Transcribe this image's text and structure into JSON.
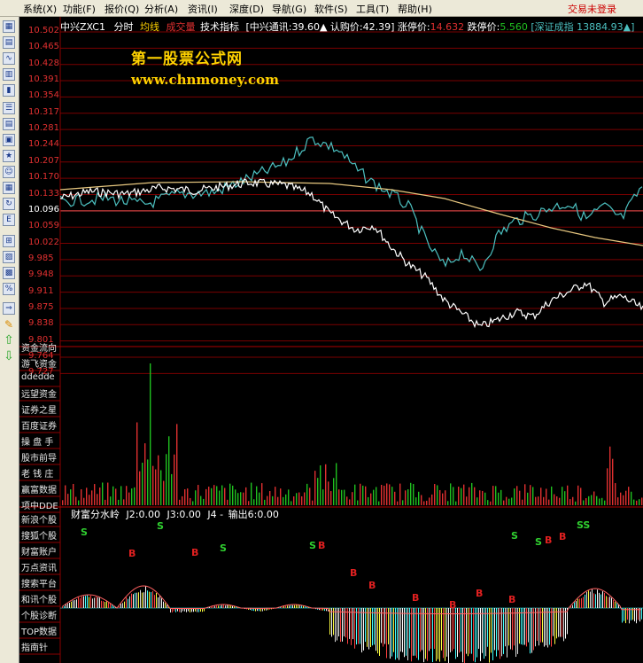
{
  "menu": [
    {
      "label": "系统(X)"
    },
    {
      "label": "功能(F)"
    },
    {
      "label": "报价(Q)"
    },
    {
      "label": "分析(A)"
    },
    {
      "label": "资讯(I)"
    },
    {
      "label": "深度(D)"
    },
    {
      "label": "导航(G)"
    },
    {
      "label": "软件(S)"
    },
    {
      "label": "工具(T)"
    },
    {
      "label": "帮助(H)"
    }
  ],
  "login_text": "交易未登录",
  "info": {
    "stock": "中兴ZXC1",
    "mode": "分时",
    "avg": "均线",
    "vol": "成交量",
    "tech": "技术指标",
    "tong": "中兴通讯:39.60▲",
    "rengou": "认购价:42.39",
    "limit_up_label": "涨停价:",
    "limit_up": "14.632",
    "limit_down_label": "跌停价:",
    "limit_down": "5.560",
    "index": "深证成指 13884.93▲"
  },
  "watermark": {
    "cn": "第一股票公式网",
    "url": "www.chnmoney.com"
  },
  "y_labels": [
    "10.502",
    "10.465",
    "10.428",
    "10.391",
    "10.354",
    "10.317",
    "10.281",
    "10.244",
    "10.207",
    "10.170",
    "10.133",
    "10.096",
    "10.059",
    "10.022",
    "9.985",
    "9.948",
    "9.911",
    "9.875",
    "9.838",
    "9.801",
    "9.764",
    "9.727"
  ],
  "sidebar": [
    "资金流向",
    "游飞资金",
    "ddedde",
    "远望资金",
    "证券之星",
    "百度证券",
    "操 盘 手",
    "股市前导",
    "老 钱 庄",
    "赢富数据",
    "项中DDE",
    "新浪个股",
    "搜狐个股",
    "财富账户",
    "万点资讯",
    "搜索平台",
    "和讯个股",
    "个股诊断",
    "TOP数据",
    "指南针"
  ],
  "indicator": {
    "title": "财富分水岭",
    "j2": "J2:0.00",
    "j3": "J3:0.00",
    "j4": "J4 -",
    "out": "输出6:0.00"
  },
  "signals_s": [
    "S",
    "S",
    "S",
    "S",
    "S",
    "S",
    "SS"
  ],
  "signals_b": [
    "B",
    "B",
    "B",
    "B",
    "B",
    "B",
    "B",
    "B",
    "B",
    "B",
    "B"
  ],
  "colors": {
    "price_line": "#ffffff",
    "avg_line": "#e8c880",
    "ref_line": "#4cc0c0",
    "grid": "#8b0000",
    "label": "#e03030",
    "up_vol": "#e03030",
    "down_vol": "#20c020"
  }
}
